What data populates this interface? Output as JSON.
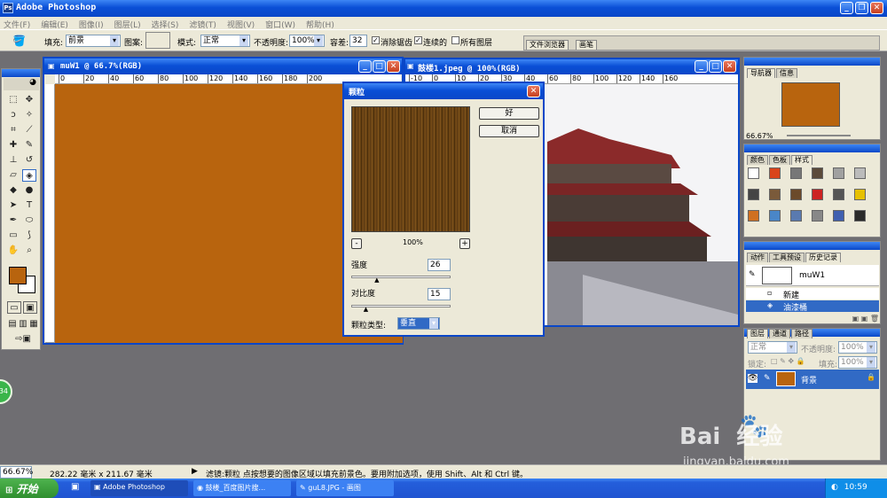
{
  "app": {
    "title": "Adobe Photoshop"
  },
  "menu": [
    "文件(F)",
    "编辑(E)",
    "图像(I)",
    "图层(L)",
    "选择(S)",
    "滤镜(T)",
    "视图(V)",
    "窗口(W)",
    "帮助(H)"
  ],
  "options": {
    "fill_label": "填充:",
    "fill_value": "前景",
    "pattern_label": "图案:",
    "mode_label": "模式:",
    "mode_value": "正常",
    "opacity_label": "不透明度:",
    "opacity_value": "100%",
    "tolerance_label": "容差:",
    "tolerance_value": "32",
    "antialias_label": "消除锯齿",
    "contiguous_label": "连续的",
    "all_layers_label": "所有图层",
    "file_browser_tab": "文件浏览器",
    "brushes_tab": "画笔"
  },
  "doc1": {
    "title": "muW1 @ 66.7%(RGB)",
    "ruler_ticks": [
      "0",
      "20",
      "40",
      "60",
      "80",
      "100",
      "120",
      "140",
      "160",
      "180",
      "200"
    ],
    "fill_color": "#b8640e"
  },
  "doc2": {
    "title": "鼓楼1.jpeg @ 100%(RGB)",
    "ruler_ticks": [
      "-10",
      "0",
      "10",
      "20",
      "30",
      "40",
      "60",
      "80",
      "100",
      "120",
      "140",
      "160"
    ]
  },
  "dialog": {
    "title": "颗粒",
    "ok_label": "好",
    "cancel_label": "取消",
    "zoom_value": "100%",
    "zoom_minus": "-",
    "zoom_plus": "+",
    "intensity_label": "强度",
    "intensity_value": "26",
    "intensity_level": 0.26,
    "contrast_label": "对比度",
    "contrast_value": "15",
    "contrast_level": 0.15,
    "grain_type_label": "颗粒类型:",
    "grain_type_value": "垂直"
  },
  "navigator": {
    "tabs": [
      "导航器",
      "信息"
    ],
    "zoom": "66.67%",
    "thumb_color": "#b8640e"
  },
  "color_panel": {
    "tabs": [
      "颜色",
      "色板",
      "样式"
    ],
    "swatches": [
      "#ffffff",
      "#d9441a",
      "#777777",
      "#5b4a3a",
      "#a0a0a0",
      "#bbbbbb",
      "#444444",
      "#7a5a3a",
      "#6b4a2a",
      "#cc2222",
      "#555555",
      "#e6c000",
      "#d07020",
      "#4a86c8",
      "#5a7ab0",
      "#888888",
      "#4060b0",
      "#2a2a2a"
    ]
  },
  "history": {
    "tabs": [
      "动作",
      "工具预设",
      "历史记录"
    ],
    "snapshot": "muW1",
    "items": [
      "新建",
      "油漆桶"
    ]
  },
  "layers": {
    "tabs": [
      "图层",
      "通道",
      "路径"
    ],
    "blend": "正常",
    "opacity_label": "不透明度:",
    "opacity_value": "100%",
    "lock_label": "锁定:",
    "fill_label": "填充:",
    "fill_value": "100%",
    "layer_name": "背景",
    "layer_color": "#b8640e"
  },
  "status": {
    "zoom": "66.67%",
    "doc_size": "282.22 毫米 x 211.67 毫米",
    "hint": "滤镜:颗粒  点按想要的图像区域以填充前景色。要用附加选项，使用 Shift、Alt 和 Ctrl 键。"
  },
  "taskbar": {
    "start": "开始",
    "tasks": [
      "Adobe Photoshop",
      "鼓楼_百度图片搜...",
      "guL8.JPG - 画图"
    ],
    "clock": "10:59"
  },
  "watermark": {
    "brand": "Bai  经验",
    "url": "jingyan.baidu.com"
  },
  "badge": "34",
  "colors": {
    "foreground": "#b8640e",
    "background": "#ffffff",
    "accent": "#0a47c8"
  }
}
